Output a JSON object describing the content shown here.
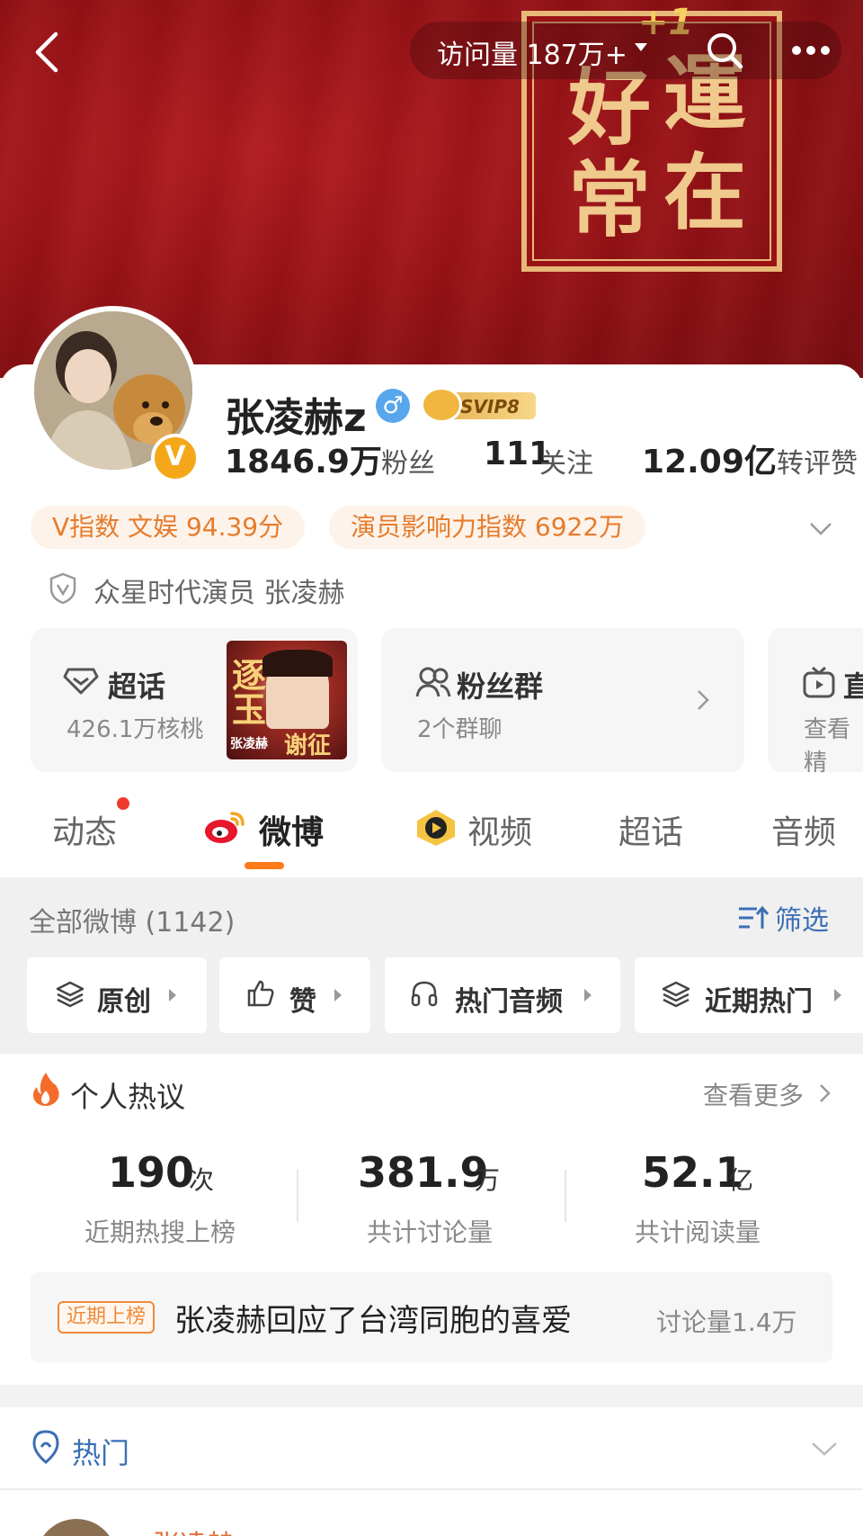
{
  "header": {
    "visits_label": "访问量 187万+",
    "plus_one": "+1",
    "banner_text": [
      "好",
      "運",
      "常",
      "在"
    ]
  },
  "profile": {
    "name": "张凌赫z",
    "gender_symbol": "♂",
    "vip_label": "SVIP8",
    "v_badge": "V",
    "stats": [
      {
        "value": "1846.9万",
        "label": "粉丝"
      },
      {
        "value": "111",
        "label": "关注"
      },
      {
        "value": "12.09亿",
        "label": "转评赞"
      }
    ],
    "tags": [
      "V指数 文娱 94.39分",
      "演员影响力指数 6922万"
    ],
    "verification": "众星时代演员 张凌赫"
  },
  "cards": {
    "supertopic": {
      "title": "超话",
      "sub": "426.1万核桃",
      "poster_title": "逐玉",
      "poster_name": "谢征",
      "poster_actor": "张凌赫"
    },
    "fan_group": {
      "title": "粉丝群",
      "sub": "2个群聊"
    },
    "live": {
      "title": "直",
      "sub": "查看精"
    }
  },
  "tabs": [
    {
      "label": "动态",
      "active": false,
      "has_dot": true
    },
    {
      "label": "微博",
      "active": true,
      "has_dot": false
    },
    {
      "label": "视频",
      "active": false,
      "has_dot": false
    },
    {
      "label": "超话",
      "active": false,
      "has_dot": false
    },
    {
      "label": "音频",
      "active": false,
      "has_dot": false
    }
  ],
  "filter": {
    "all_weibo": "全部微博 (1142)",
    "filter_label": "筛选",
    "chips": [
      "原创",
      "赞",
      "热门音频",
      "近期热门"
    ]
  },
  "personal_hot": {
    "title": "个人热议",
    "see_more": "查看更多",
    "stats": [
      {
        "value": "190",
        "unit": "次",
        "label": "近期热搜上榜"
      },
      {
        "value": "381.9",
        "unit": "万",
        "label": "共计讨论量"
      },
      {
        "value": "52.1",
        "unit": "亿",
        "label": "共计阅读量"
      }
    ],
    "recent_tag": "近期上榜",
    "recent_title": "张凌赫回应了台湾同胞的喜爱",
    "recent_count": "讨论量1.4万"
  },
  "hot_section": {
    "title": "热门",
    "post_author": "张凌赫"
  },
  "colors": {
    "banner_red": "#9a1216",
    "accent_orange": "#ff7a1a",
    "link_blue": "#3b6fb6",
    "tag_orange": "#e67b2c"
  }
}
